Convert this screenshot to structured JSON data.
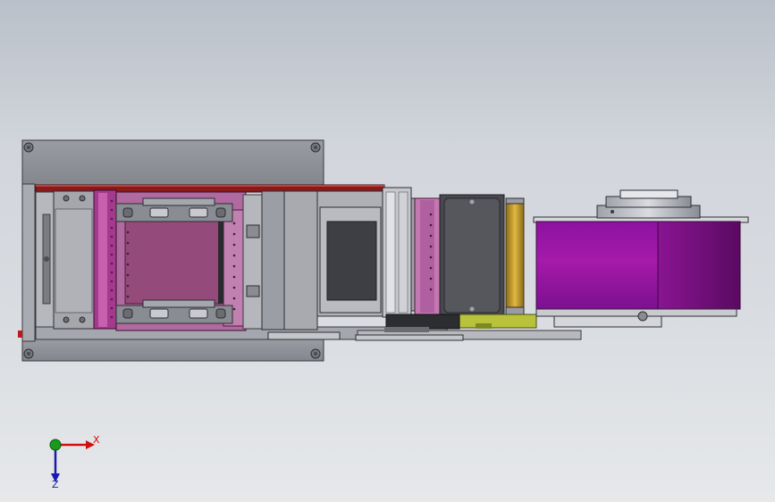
{
  "viewport": {
    "background_top": "#b9c0c9",
    "background_bottom": "#e6e8ea"
  },
  "colors": {
    "frame_gray": "#8d8f96",
    "frame_dark": "#5d5f66",
    "magenta": "#a33a8e",
    "magenta_light": "#c860b0",
    "pink_plate": "#944a7a",
    "dark_red": "#8a1a1a",
    "purple_roll": "#9a16a0",
    "purple_roll_dark": "#6a0d70",
    "yellow_roller": "#c9a23a",
    "green_plate": "#b8c23a",
    "dark_box": "#47494f",
    "screen": "#3d3f45"
  },
  "triad": {
    "x_label": "X",
    "z_label": "Z",
    "x_color": "#d01010",
    "y_color": "#1a9a1a",
    "z_color": "#1a1ab0"
  }
}
